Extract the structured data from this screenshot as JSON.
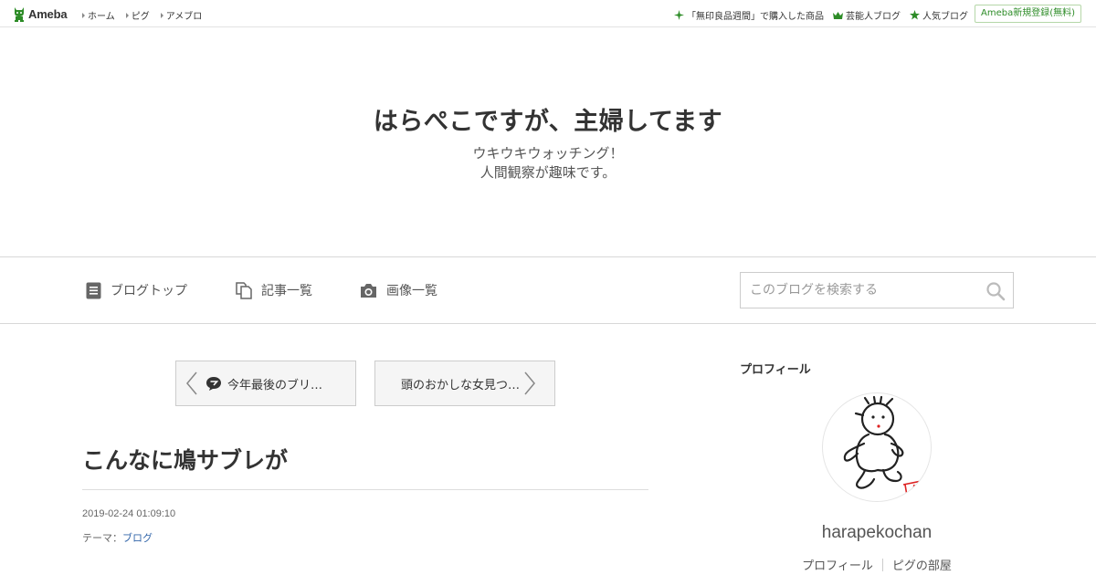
{
  "topbar": {
    "logo_text": "Ameba",
    "nav": [
      {
        "label": "ホーム"
      },
      {
        "label": "ピグ"
      },
      {
        "label": "アメブロ"
      }
    ],
    "right_links": [
      {
        "label": "「無印良品週間」で購入した商品",
        "icon": "sparkle-icon"
      },
      {
        "label": "芸能人ブログ",
        "icon": "crown-icon"
      },
      {
        "label": "人気ブログ",
        "icon": "star-icon"
      }
    ],
    "signup_label": "Ameba新規登録(無料)",
    "accent_color": "#2d8c27"
  },
  "header": {
    "title": "はらぺこですが、主婦してます",
    "description_line1": "ウキウキウォッチング！",
    "description_line2": "人間観察が趣味です。"
  },
  "navbar": {
    "items": [
      {
        "label": "ブログトップ",
        "icon": "document-icon"
      },
      {
        "label": "記事一覧",
        "icon": "copy-icon"
      },
      {
        "label": "画像一覧",
        "icon": "camera-icon"
      }
    ],
    "search_placeholder": "このブログを検索する"
  },
  "article": {
    "prev_label": "今年最後のブリ…",
    "next_label": "頭のおかしな女見つ…",
    "title": "こんなに鳩サブレが",
    "date": "2019-02-24 01:09:10",
    "theme_prefix": "テーマ：",
    "theme_link": "ブログ"
  },
  "sidebar": {
    "heading": "プロフィール",
    "username": "harapekochan",
    "links": [
      {
        "label": "プロフィール"
      },
      {
        "label": "ピグの部屋"
      }
    ]
  }
}
